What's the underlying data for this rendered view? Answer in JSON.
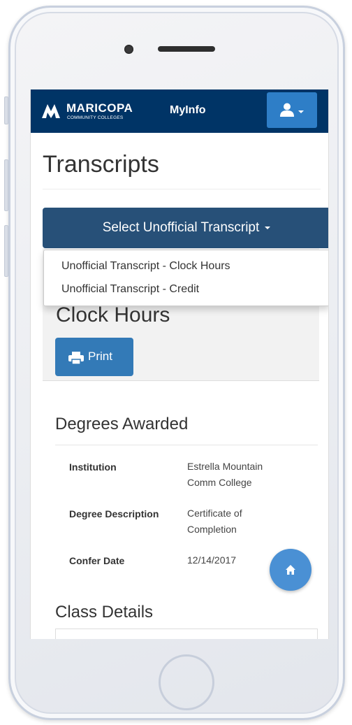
{
  "header": {
    "logo_name": "MARICOPA",
    "logo_sub": "COMMUNITY COLLEGES",
    "app_title": "MyInfo"
  },
  "page": {
    "title": "Transcripts"
  },
  "transcript_select": {
    "label": "Select Unofficial Transcript",
    "options": [
      "Unofficial Transcript - Clock Hours",
      "Unofficial Transcript - Credit"
    ]
  },
  "section": {
    "title": "Clock Hours",
    "print_label": "Print"
  },
  "degrees": {
    "title": "Degrees Awarded",
    "rows": [
      {
        "label": "Institution",
        "value": "Estrella Mountain Comm College"
      },
      {
        "label": "Degree Description",
        "value": "Certificate of Completion"
      },
      {
        "label": "Confer Date",
        "value": "12/14/2017"
      }
    ]
  },
  "class_details": {
    "title": "Class Details"
  },
  "colors": {
    "navbar": "#003466",
    "select_button": "#275078",
    "primary_button": "#337ab7",
    "fab": "#4a90d4"
  },
  "icons": {
    "user": "user-icon",
    "print": "print-icon",
    "home": "home-icon",
    "logo": "maricopa-logo-icon"
  }
}
